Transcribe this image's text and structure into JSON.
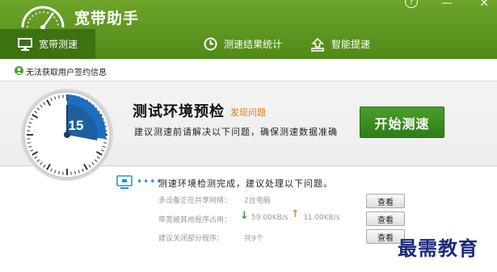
{
  "app": {
    "title": "宽带助手"
  },
  "tabs": [
    {
      "label": "宽带测速",
      "icon": "monitor-icon"
    },
    {
      "label": "测速结果统计",
      "icon": "clock-icon"
    },
    {
      "label": "智能提速",
      "icon": "upload-icon"
    }
  ],
  "notice": {
    "text": "无法获取用户签约信息",
    "icon": "user-icon"
  },
  "check": {
    "countdown": "15",
    "title": "测试环境预检",
    "issue_link": "发现问题",
    "subtitle": "建议测速前请解决以下问题，确保测速数据准确",
    "start_button": "开始测速"
  },
  "results": {
    "title": "测速环境检测完成，建议处理以下问题。",
    "dots": "••••",
    "rows": [
      {
        "label": "多设备正在共享网络：",
        "value": "2台电脑",
        "button": "查看"
      },
      {
        "label": "带宽被其他程序占用：",
        "download": "59.00KB/s",
        "upload": "31.00KB/s",
        "button": "查看"
      },
      {
        "label": "建议关闭部分程序：",
        "value": "共9个",
        "button": "查看"
      }
    ]
  },
  "watermark": "最需教育",
  "colors": {
    "brand_green": "#5a9520",
    "active_tab": "#3d7210",
    "dial_blue": "#1a6fc0",
    "link_orange": "#e07a10",
    "down_arrow": "#3a9a2a",
    "up_arrow": "#f08a20"
  }
}
